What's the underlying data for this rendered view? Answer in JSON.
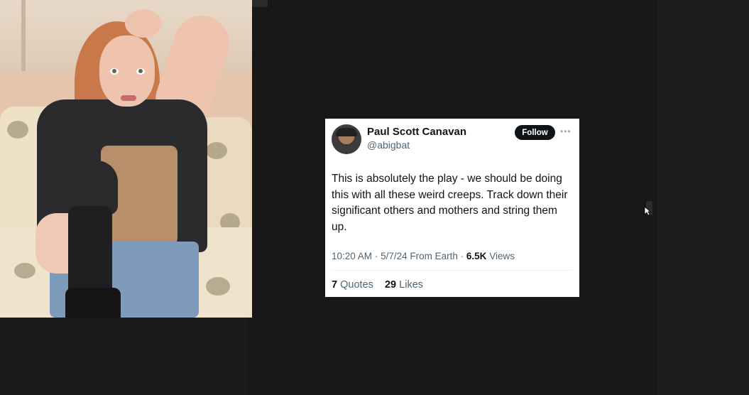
{
  "tweet": {
    "display_name": "Paul Scott Canavan",
    "handle": "@abigbat",
    "follow_label": "Follow",
    "more_icon": "more-horizontal-icon",
    "text": "This is absolutely the play - we should be doing this with all these weird creeps. Track down their significant others and mothers and string them up.",
    "time": "10:20 AM",
    "date": "5/7/24",
    "source": "From Earth",
    "views_count": "6.5K",
    "views_label": "Views",
    "quotes_count": "7",
    "quotes_label": "Quotes",
    "likes_count": "29",
    "likes_label": "Likes"
  },
  "icons": {
    "cursor": "mouse-pointer-icon"
  },
  "colors": {
    "background": "#1c1c1c",
    "card": "#ffffff",
    "text_primary": "#0f1419",
    "text_secondary": "#536471",
    "follow_button": "#0f1419"
  }
}
